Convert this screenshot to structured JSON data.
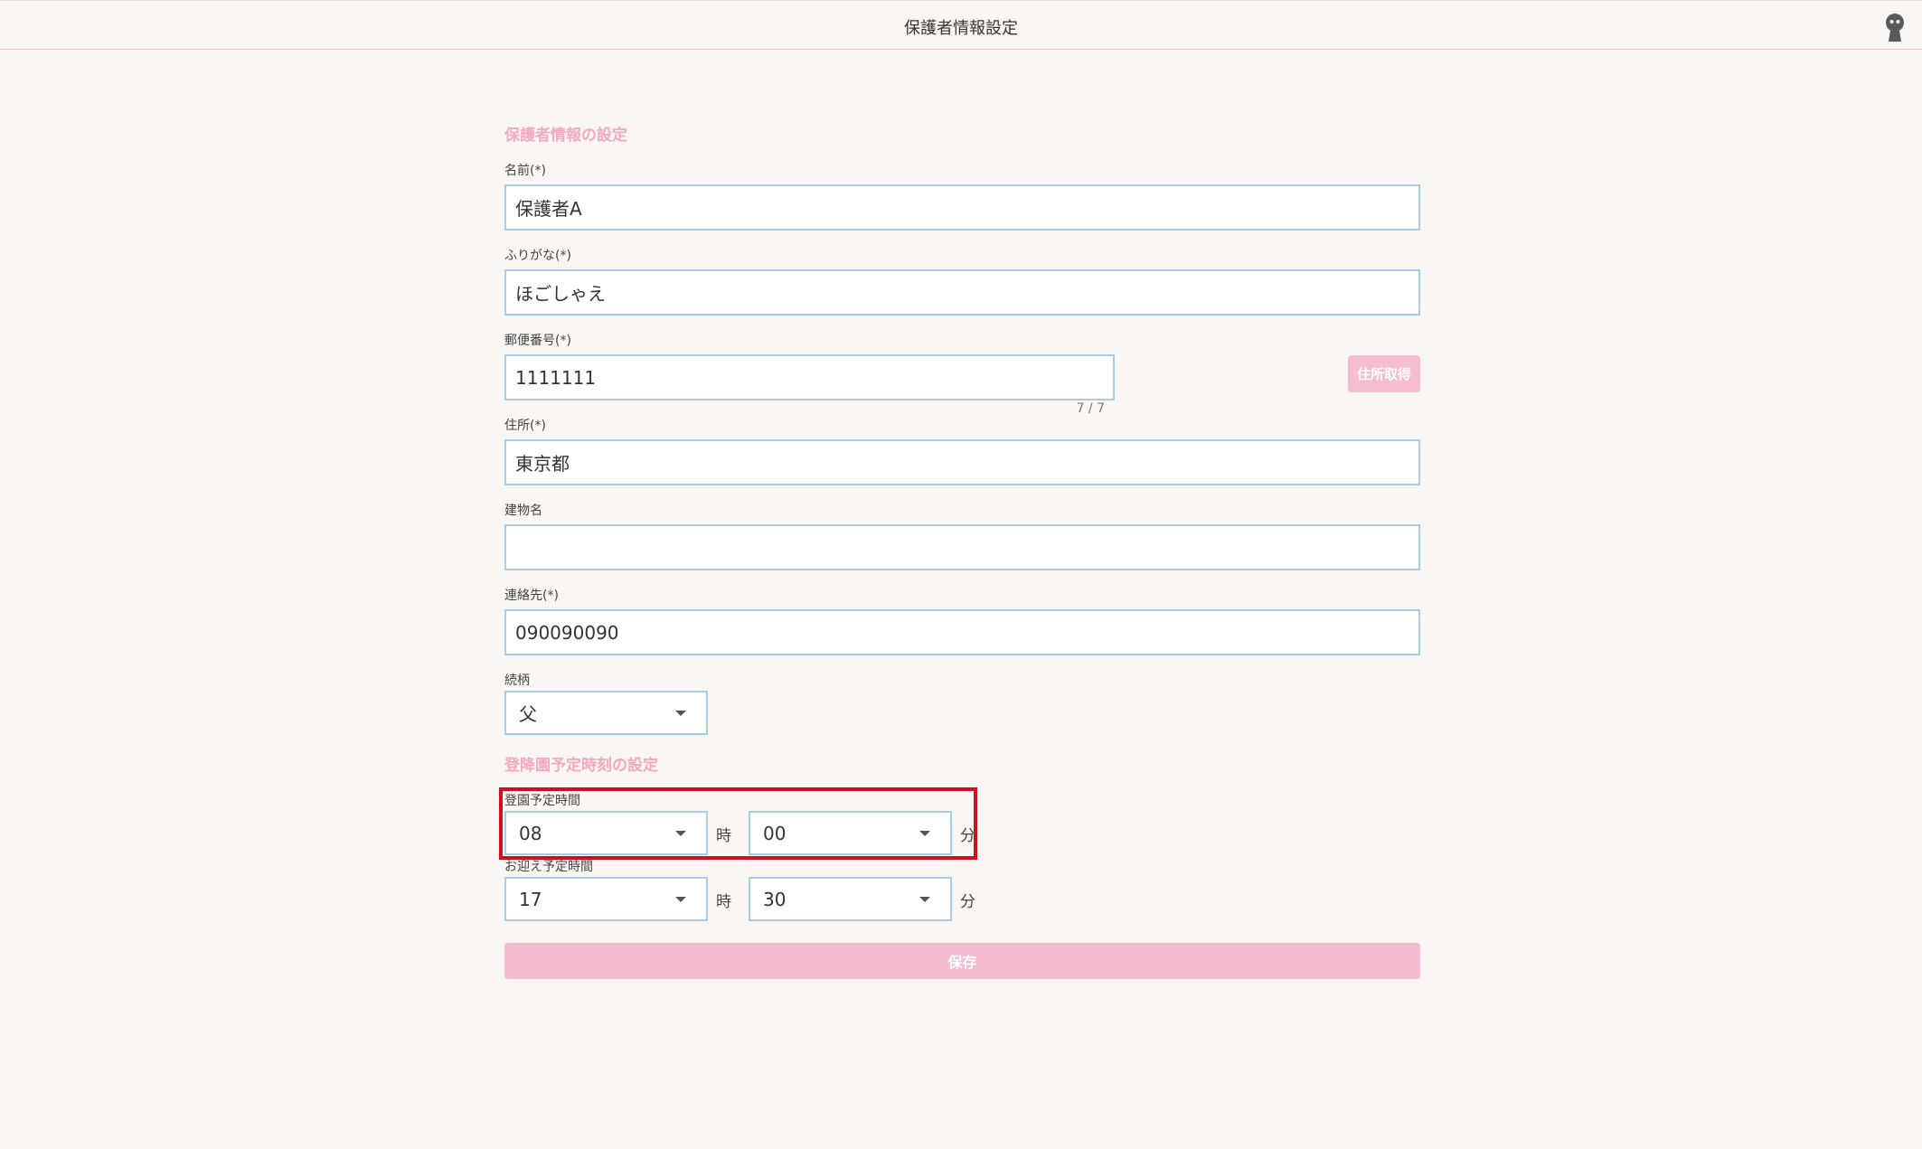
{
  "header": {
    "title": "保護者情報設定",
    "avatar_icon": "user-avatar-icon"
  },
  "guardian_section": {
    "title": "保護者情報の設定",
    "name": {
      "label": "名前(*)",
      "value": "保護者A"
    },
    "furigana": {
      "label": "ふりがな(*)",
      "value": "ほごしゃえ"
    },
    "postal_code": {
      "label": "郵便番号(*)",
      "value": "1111111",
      "counter": "7 / 7",
      "lookup_button": "住所取得"
    },
    "address": {
      "label": "住所(*)",
      "value": "東京都"
    },
    "building": {
      "label": "建物名",
      "value": ""
    },
    "contact": {
      "label": "連絡先(*)",
      "value": "090090090"
    },
    "relationship": {
      "label": "続柄",
      "value": "父"
    }
  },
  "schedule_section": {
    "title": "登降園予定時刻の設定",
    "dropoff": {
      "label": "登園予定時間",
      "hour": "08",
      "hour_unit": "時",
      "minute": "00",
      "minute_unit": "分"
    },
    "pickup": {
      "label": "お迎え予定時間",
      "hour": "17",
      "hour_unit": "時",
      "minute": "30",
      "minute_unit": "分"
    }
  },
  "save_button": "保存",
  "colors": {
    "accent_pink": "#f3a9c1",
    "field_border": "#a9cde6",
    "highlight_red": "#d0101f",
    "background": "#f9f6f3"
  }
}
